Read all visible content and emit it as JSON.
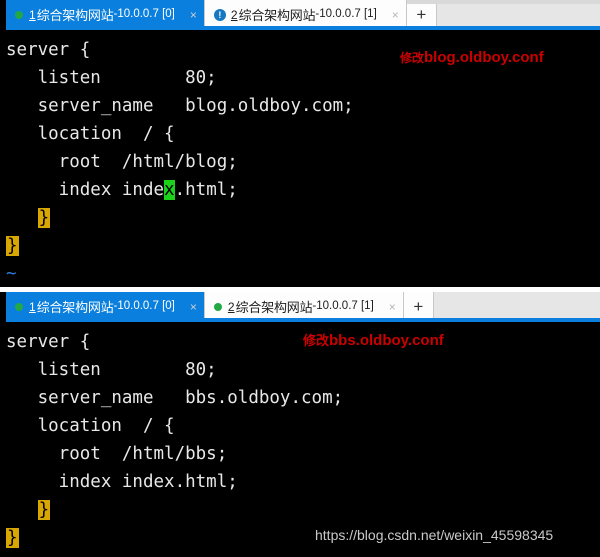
{
  "panes": [
    {
      "id": "pane-blog",
      "tabs": [
        {
          "status_icon": "green-dot-icon",
          "index": "1",
          "name_cn": "综合架构网站",
          "address": "-10.0.0.7 [0]",
          "close_label": "×",
          "state": "active"
        },
        {
          "status_icon": "blue-exclamation-icon",
          "icon_glyph": "!",
          "index": "2",
          "name_cn": "综合架构网站",
          "address": "-10.0.0.7 [1]",
          "close_label": "×",
          "state": "inactive"
        }
      ],
      "new_tab_label": "+",
      "annotation": {
        "cn": "修改",
        "en": "blog.oldboy.conf"
      },
      "terminal_lines": [
        "server {",
        "   listen        80;",
        "   server_name   blog.oldboy.com;",
        "   location  / {",
        "     root  /html/blog;",
        "     index index.html;",
        "   }",
        "}",
        "~"
      ],
      "cursor_char": "x",
      "cursor_line_index": 5,
      "cursor_col": 15
    },
    {
      "id": "pane-bbs",
      "tabs": [
        {
          "status_icon": "green-dot-icon",
          "index": "1",
          "name_cn": "综合架构网站",
          "address": "-10.0.0.7 [0]",
          "close_label": "×",
          "state": "active"
        },
        {
          "status_icon": "green-dot-icon",
          "index": "2",
          "name_cn": "综合架构网站",
          "address": "-10.0.0.7 [1]",
          "close_label": "×",
          "state": "inactive"
        }
      ],
      "new_tab_label": "+",
      "annotation": {
        "cn": "修改",
        "en": "bbs.oldboy.conf"
      },
      "terminal_lines": [
        "server {",
        "   listen        80;",
        "   server_name   bbs.oldboy.com;",
        "   location  / {",
        "     root  /html/bbs;",
        "     index index.html;",
        "   }",
        "}"
      ]
    }
  ],
  "lines": {
    "top": {
      "l1": "server {",
      "l2": "   listen        80;",
      "l3": "   server_name   blog.oldboy.com;",
      "l4": "   location  / {",
      "l5": "     root  /html/blog;",
      "l6a": "     index inde",
      "l6b": "x",
      "l6c": ".html;",
      "l7_indent": "   ",
      "l7_brace": "}",
      "l8_brace": "}",
      "l9_tilde": "~"
    },
    "bottom": {
      "l1": "server {",
      "l2": "   listen        80;",
      "l3": "   server_name   bbs.oldboy.com;",
      "l4": "   location  / {",
      "l5": "     root  /html/bbs;",
      "l6": "     index index.html;",
      "l7_indent": "   ",
      "l7_brace": "}",
      "l8_brace": "}"
    }
  },
  "watermark": "https://blog.csdn.net/weixin_45598345",
  "colors": {
    "tab_active_blue": "#0a7fdd",
    "tab_inactive_white": "#fdfdfd",
    "strip_gray": "#e6e6e6",
    "terminal_bg": "#000000",
    "terminal_fg": "#e8e8e8",
    "brace_highlight": "#d8a800",
    "cursor_green": "#19d219",
    "annotation_red": "#cc0000",
    "status_green": "#22a844",
    "status_blue": "#1678c2",
    "tilde_blue": "#2d7fd6",
    "watermark_gray": "#c9c9c9"
  }
}
